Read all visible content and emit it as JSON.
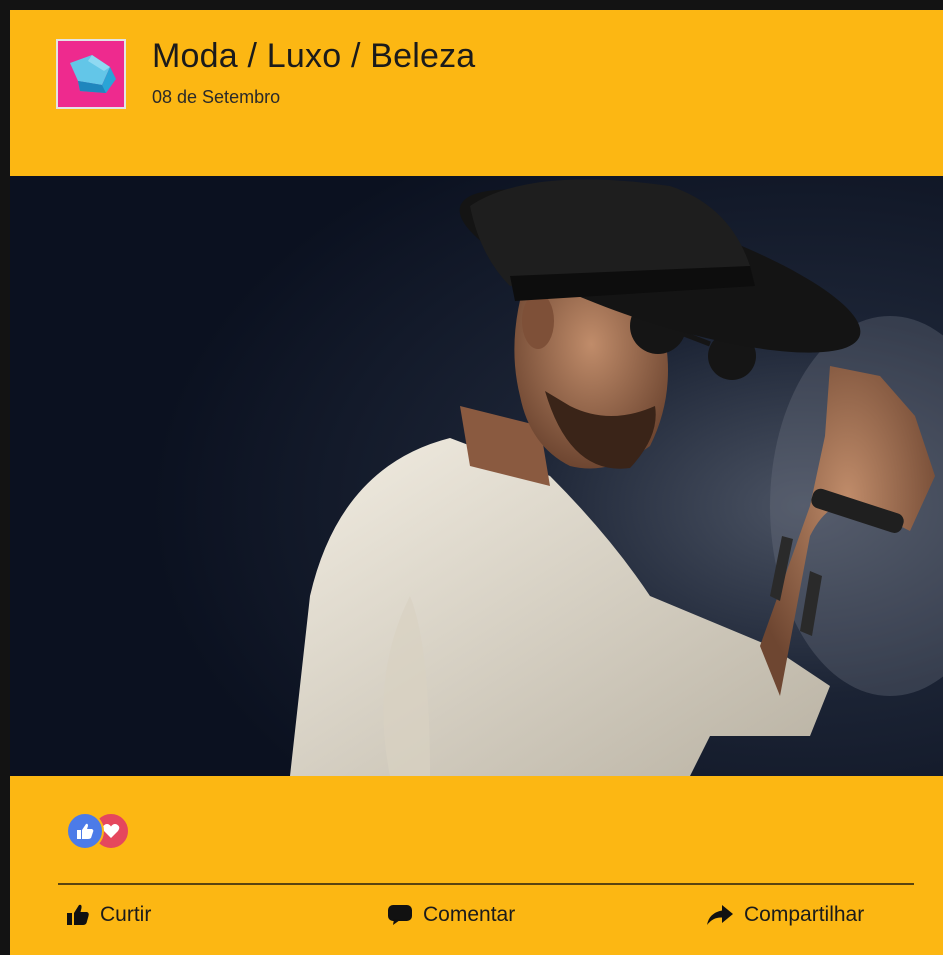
{
  "post": {
    "page_name": "Moda / Luxo / Beleza",
    "date": "08 de Setembro",
    "avatar_icon": "bucket-hat-icon",
    "photo_icon": "man-in-hat-photo"
  },
  "reactions": {
    "icons": [
      "like-icon",
      "love-icon"
    ]
  },
  "actions": {
    "like_label": "Curtir",
    "comment_label": "Comentar",
    "share_label": "Compartilhar"
  },
  "colors": {
    "card_background": "#fcb713",
    "border": "#131313",
    "avatar_background": "#ee2a8e",
    "like_reaction": "#4c7be8",
    "love_reaction": "#e5475d"
  }
}
